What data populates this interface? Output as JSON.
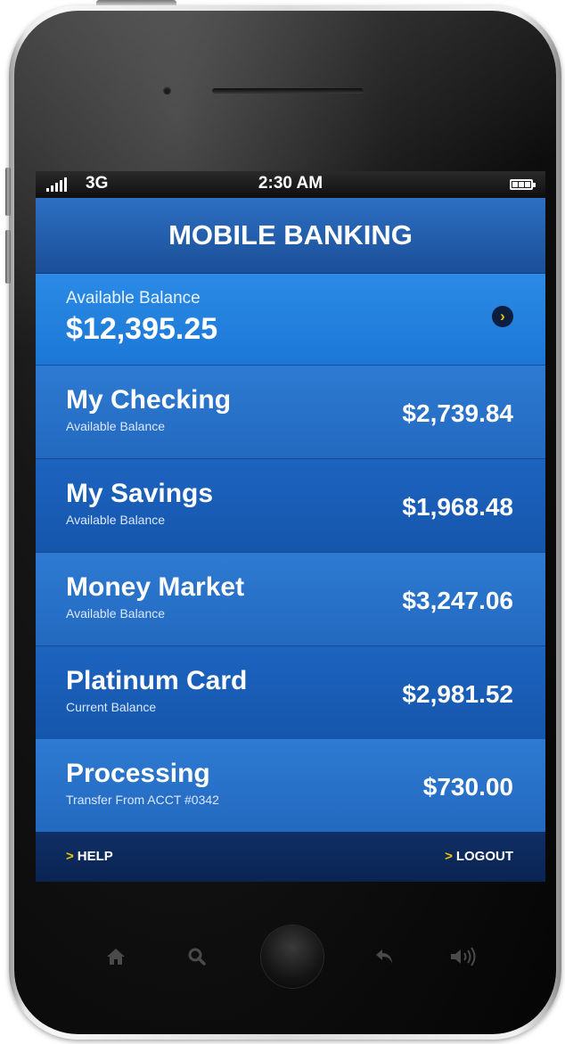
{
  "status_bar": {
    "network": "3G",
    "time": "2:30 AM"
  },
  "header": {
    "title": "MOBILE BANKING"
  },
  "summary": {
    "label": "Available Balance",
    "value": "$12,395.25"
  },
  "accounts": [
    {
      "name": "My Checking",
      "subtitle": "Available Balance",
      "amount": "$2,739.84"
    },
    {
      "name": "My Savings",
      "subtitle": "Available Balance",
      "amount": "$1,968.48"
    },
    {
      "name": "Money Market",
      "subtitle": "Available Balance",
      "amount": "$3,247.06"
    },
    {
      "name": "Platinum Card",
      "subtitle": "Current Balance",
      "amount": "$2,981.52"
    },
    {
      "name": "Processing",
      "subtitle": "Transfer From ACCT #0342",
      "amount": "$730.00"
    }
  ],
  "footer": {
    "help_label": "HELP",
    "logout_label": "LOGOUT"
  },
  "icons": {
    "home": "home-icon",
    "search": "search-icon",
    "back": "back-icon",
    "volume": "volume-icon",
    "chevron": "chevron-right-icon"
  },
  "colors": {
    "accent_yellow": "#f2c300",
    "header_blue": "#2d6fc1",
    "banner_blue": "#2b8be6",
    "footer_navy": "#0f2f66"
  }
}
